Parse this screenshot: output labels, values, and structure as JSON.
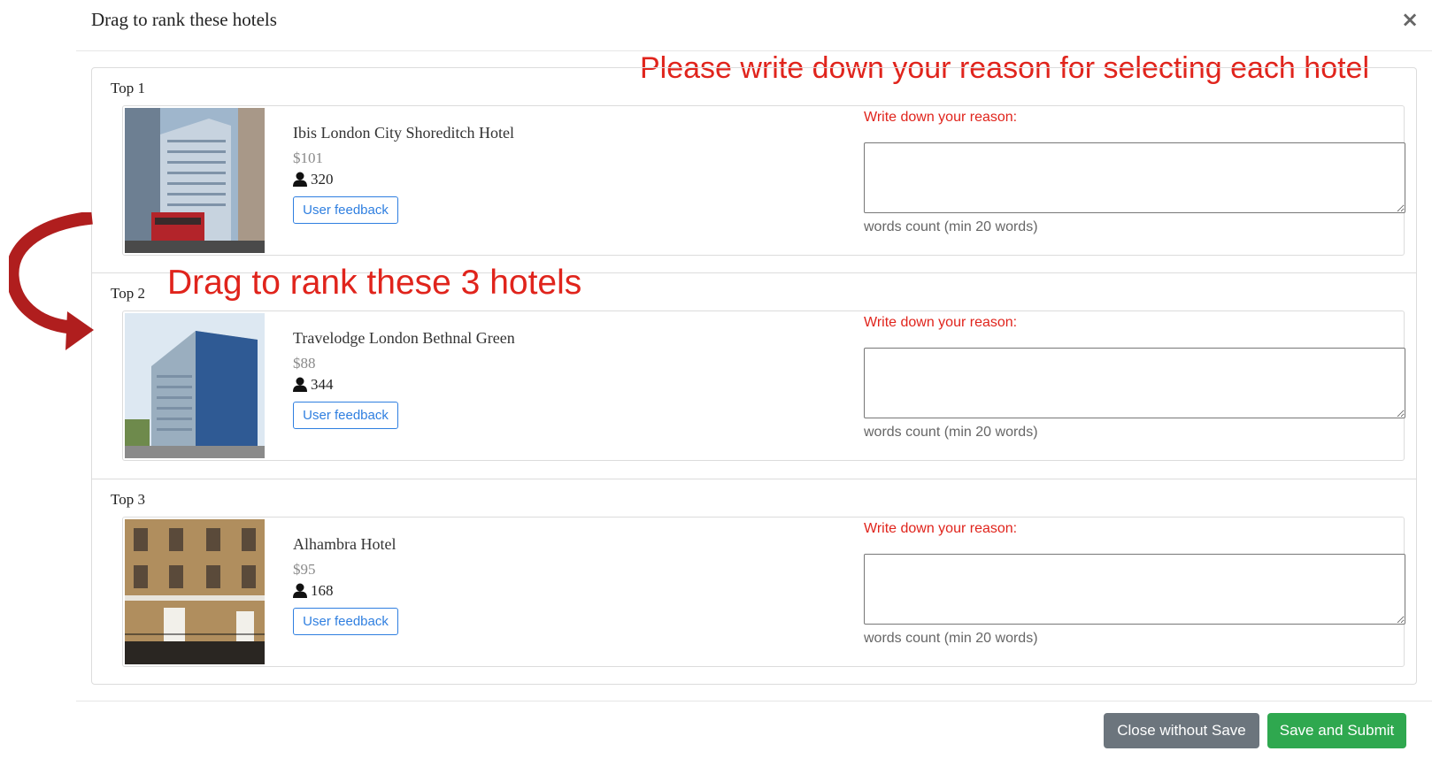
{
  "modal": {
    "title": "Drag to rank these hotels",
    "close_symbol": "×"
  },
  "annotations": {
    "top_note": "Please write down your reason for selecting each hotel",
    "drag_note": "Drag to rank these 3 hotels",
    "color": "#e0241c"
  },
  "ranks": [
    {
      "label": "Top 1",
      "hotel": {
        "name": "Ibis London City Shoreditch Hotel",
        "price": "$101",
        "count": "320",
        "feedback_label": "User feedback"
      },
      "reason_label": "Write down your reason:",
      "reason_value": "",
      "word_count": "words count (min 20 words)"
    },
    {
      "label": "Top 2",
      "hotel": {
        "name": "Travelodge London Bethnal Green",
        "price": "$88",
        "count": "344",
        "feedback_label": "User feedback"
      },
      "reason_label": "Write down your reason:",
      "reason_value": "",
      "word_count": "words count (min 20 words)"
    },
    {
      "label": "Top 3",
      "hotel": {
        "name": "Alhambra Hotel",
        "price": "$95",
        "count": "168",
        "feedback_label": "User feedback"
      },
      "reason_label": "Write down your reason:",
      "reason_value": "",
      "word_count": "words count (min 20 words)"
    }
  ],
  "footer": {
    "close_label": "Close without Save",
    "save_label": "Save and Submit",
    "close_color": "#6c757d",
    "save_color": "#2fa84f"
  },
  "icons": {
    "close": "close-icon",
    "user": "user-icon",
    "arrow": "curved-arrow-icon"
  }
}
